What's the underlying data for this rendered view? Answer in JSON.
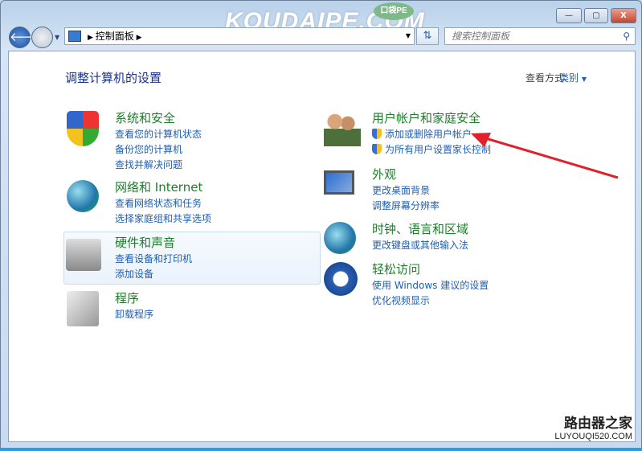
{
  "window": {
    "watermark": "KOUDAIPE.COM",
    "watermark_badge": "口袋PE",
    "minimize": "—",
    "maximize": "▢",
    "close": "X"
  },
  "address": {
    "breadcrumb": "控制面板",
    "search_placeholder": "搜索控制面板"
  },
  "main": {
    "heading": "调整计算机的设置",
    "view_by_label": "查看方式:",
    "view_by_value": "类别"
  },
  "categories": [
    {
      "title": "系统和安全",
      "links": [
        "查看您的计算机状态",
        "备份您的计算机",
        "查找并解决问题"
      ]
    },
    {
      "title": "网络和 Internet",
      "links": [
        "查看网络状态和任务",
        "选择家庭组和共享选项"
      ]
    },
    {
      "title": "硬件和声音",
      "links": [
        "查看设备和打印机",
        "添加设备"
      ]
    },
    {
      "title": "程序",
      "links": [
        "卸载程序"
      ]
    },
    {
      "title": "用户帐户和家庭安全",
      "links": [
        "添加或删除用户帐户",
        "为所有用户设置家长控制"
      ]
    },
    {
      "title": "外观",
      "links": [
        "更改桌面背景",
        "调整屏幕分辨率"
      ]
    },
    {
      "title": "时钟、语言和区域",
      "links": [
        "更改键盘或其他输入法"
      ]
    },
    {
      "title": "轻松访问",
      "links": [
        "使用 Windows 建议的设置",
        "优化视频显示"
      ]
    }
  ],
  "footer": {
    "site_name": "路由器之家",
    "site_url": "LUYOUQI520.COM"
  },
  "colors": {
    "title_green": "#1e7d2a",
    "link_blue": "#1e5fb4",
    "arrow_red": "#e0202a"
  }
}
